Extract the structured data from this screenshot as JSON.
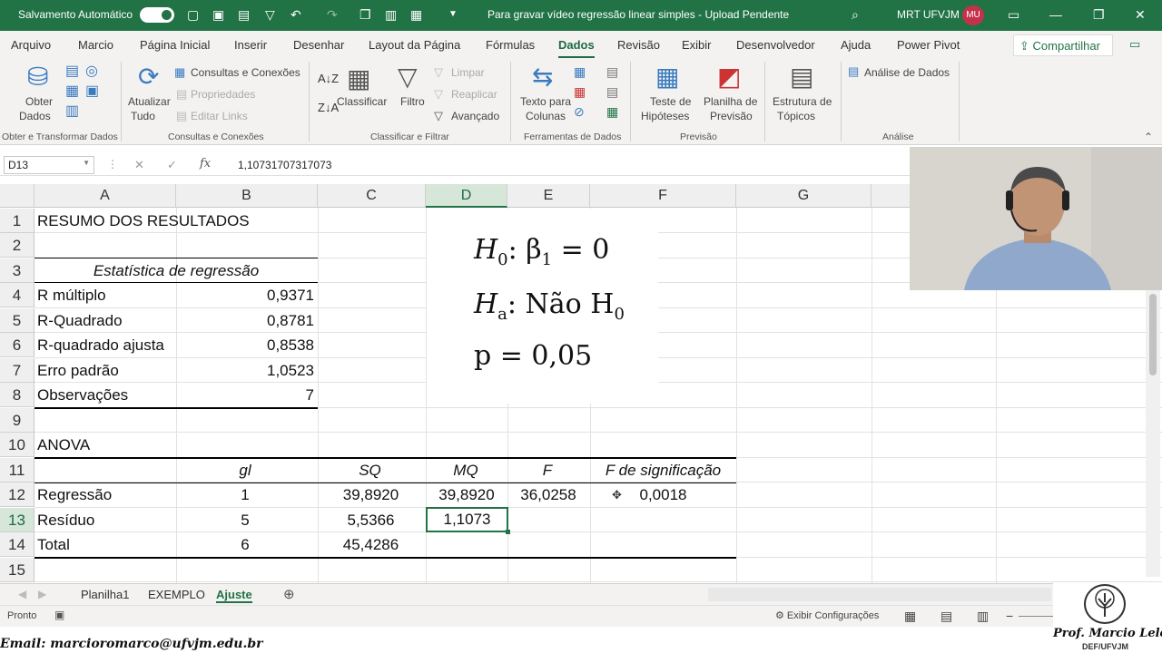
{
  "titlebar": {
    "autosave": "Salvamento Automático",
    "doc_title": "Para gravar vídeo regressão linear simples  -  Upload Pendente",
    "user": "MRT UFVJM",
    "avatar": "MU"
  },
  "menu": [
    "Arquivo",
    "Marcio",
    "Página Inicial",
    "Inserir",
    "Desenhar",
    "Layout da Página",
    "Fórmulas",
    "Dados",
    "Revisão",
    "Exibir",
    "Desenvolvedor",
    "Ajuda",
    "Power Pivot"
  ],
  "share": "Compartilhar",
  "ribbon": {
    "obter1": "Obter",
    "obter2": "Dados",
    "atual1": "Atualizar",
    "atual2": "Tudo",
    "consultas": "Consultas e Conexões",
    "propriedades": "Propriedades",
    "editar": "Editar Links",
    "classificar": "Classificar",
    "filtro": "Filtro",
    "limpar": "Limpar",
    "reaplicar": "Reaplicar",
    "avancado": "Avançado",
    "texto1": "Texto para",
    "texto2": "Colunas",
    "teste1": "Teste de",
    "teste2": "Hipóteses",
    "planilha1": "Planilha de",
    "planilha2": "Previsão",
    "estrutura1": "Estrutura de",
    "estrutura2": "Tópicos",
    "analise": "Análise de Dados",
    "groups": [
      "Obter e Transformar Dados",
      "Consultas e Conexões",
      "Classificar e Filtrar",
      "Ferramentas de Dados",
      "Previsão",
      "Análise"
    ]
  },
  "formula_bar": {
    "name_box": "D13",
    "value": "1,10731707317073"
  },
  "columns": [
    "A",
    "B",
    "C",
    "D",
    "E",
    "F",
    "G"
  ],
  "rows": [
    "1",
    "2",
    "3",
    "4",
    "5",
    "6",
    "7",
    "8",
    "9",
    "10",
    "11",
    "12",
    "13",
    "14",
    "15"
  ],
  "sheet": {
    "r1": "RESUMO DOS RESULTADOS",
    "r3": "Estatística de regressão",
    "r4": [
      "R múltiplo",
      "0,9371"
    ],
    "r5": [
      "R-Quadrado",
      "0,8781"
    ],
    "r6": [
      "R-quadrado ajusta",
      "0,8538"
    ],
    "r7": [
      "Erro padrão",
      "1,0523"
    ],
    "r8": [
      "Observações",
      "7"
    ],
    "r10": "ANOVA",
    "r11": [
      "gl",
      "SQ",
      "MQ",
      "F",
      "F de significação"
    ],
    "r12": [
      "Regressão",
      "1",
      "39,8920",
      "39,8920",
      "36,0258",
      "0,0018"
    ],
    "r13": [
      "Resíduo",
      "5",
      "5,5366",
      "1,1073"
    ],
    "r14": [
      "Total",
      "6",
      "45,4286"
    ]
  },
  "hypotheses": {
    "h0_sym": "H",
    "h0_sub": "0",
    "h0_rest": ":  β",
    "h0_beta_sub": "1",
    "h0_eq": " = 0",
    "ha_sym": "H",
    "ha_sub": "a",
    "ha_text": ": Não  H",
    "ha_h_sub": "0",
    "p": "p = 0,05"
  },
  "sheet_tabs": [
    "Planilha1",
    "EXEMPLO",
    "Ajuste"
  ],
  "status": {
    "ready": "Pronto",
    "settings": "Exibir Configurações"
  },
  "footer": {
    "email": "Email: marcioromarco@ufvjm.edu.br",
    "name": "Prof. Marcio Leles",
    "dept": "DEF/UFVJM"
  },
  "colors": {
    "excel_green": "#217346",
    "avatar": "#c4314b"
  }
}
